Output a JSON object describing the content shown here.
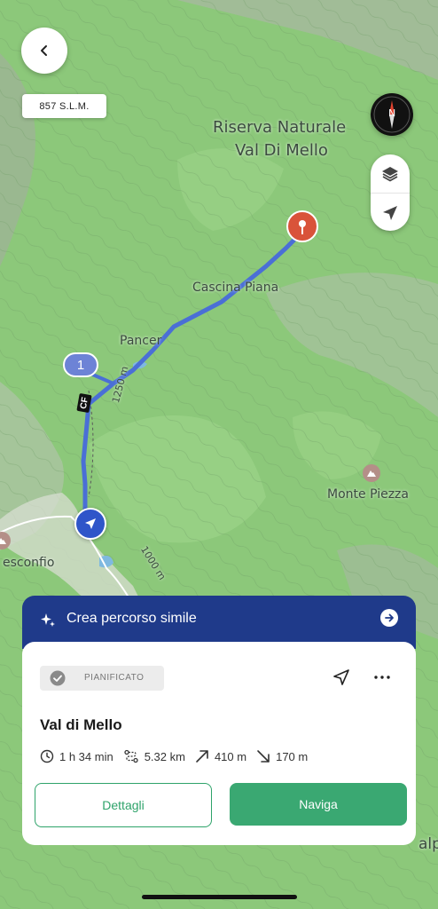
{
  "map": {
    "labels": {
      "reserve_line1": "Riserva Naturale",
      "reserve_line2": "Val Di Mello",
      "cascina": "Cascina Piana",
      "pancer": "Pancer",
      "monte": "Monte Piezza",
      "town": "esconfio",
      "alp": "alp",
      "contour_1250": "1250 m",
      "contour_1000": "1000 m",
      "trail_code": "CF",
      "waypoint_number": "1"
    }
  },
  "header": {
    "back_icon": "chevron-left-icon",
    "elevation": "857 S.L.M."
  },
  "controls": {
    "compass_icon": "compass-icon",
    "compass_letter": "N",
    "layers_icon": "layers-icon",
    "locate_icon": "location-arrow-icon"
  },
  "sheet": {
    "banner_title": "Crea percorso simile",
    "status_badge": "PIANIFICATO",
    "route_name": "Val di Mello",
    "duration": "1 h 34 min",
    "distance": "5.32 km",
    "ascent": "410 m",
    "descent": "170 m",
    "details_label": "Dettagli",
    "navigate_label": "Naviga",
    "colors": {
      "primary": "#1f3a8a",
      "accent": "#3aa872",
      "pin": "#d9533a",
      "route": "#4a6fd6"
    }
  }
}
